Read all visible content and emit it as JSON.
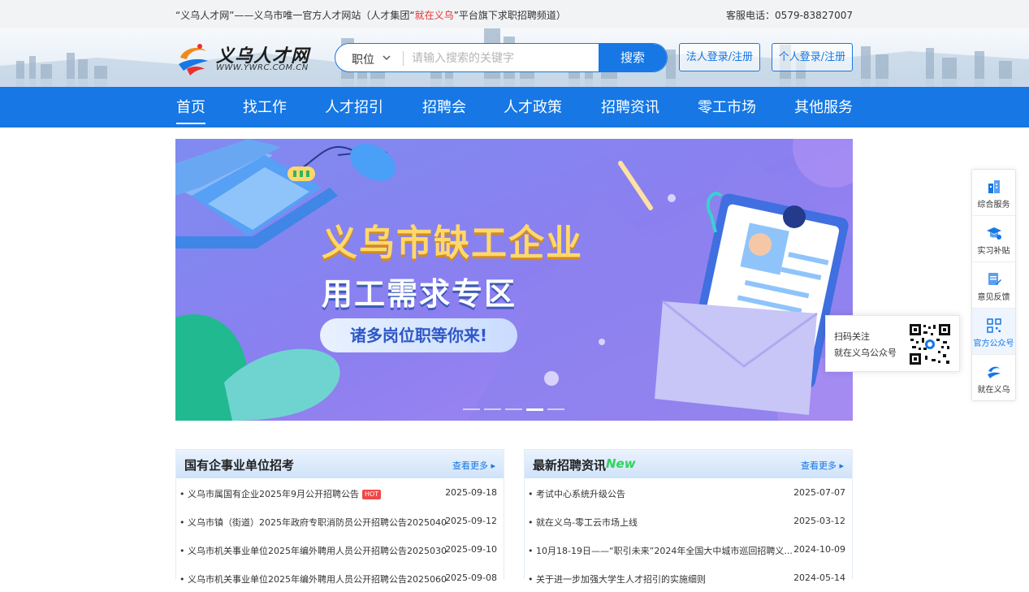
{
  "topbar": {
    "intro_part1": "“义乌人才网”——义乌市唯一官方人才网站（人才集团“",
    "intro_brand": "就在义乌",
    "intro_part2": "”平台旗下求职招聘频道）",
    "hotline": "客服电话：0579-83827007"
  },
  "logo": {
    "name": "义乌人才网",
    "url": "WWW.YWRC.COM.CN"
  },
  "search": {
    "category": "职位",
    "placeholder": "请输入搜索的关键字",
    "button": "搜索"
  },
  "login": {
    "corporate": "法人登录/注册",
    "personal": "个人登录/注册"
  },
  "nav": [
    "首页",
    "找工作",
    "人才招引",
    "招聘会",
    "人才政策",
    "招聘资讯",
    "零工市场",
    "其他服务"
  ],
  "banner": {
    "title_line1": "义乌市缺工企业",
    "title_line2": "用工需求专区",
    "slogan": "诸多岗位职等你来!",
    "slides_total": 5,
    "active_slide": 4
  },
  "panels": {
    "left": {
      "title": "国有企事业单位招考",
      "more": "查看更多",
      "items": [
        {
          "text": "• 义乌市属国有企业2025年9月公开招聘公告",
          "badge": "HOT",
          "date": "2025-09-18"
        },
        {
          "text": "• 义乌市镇（街道）2025年政府专职消防员公开招聘公告20250403",
          "badge": "",
          "date": "2025-09-12"
        },
        {
          "text": "• 义乌市机关事业单位2025年编外聘用人员公开招聘公告20250301",
          "badge": "",
          "date": "2025-09-10"
        },
        {
          "text": "• 义乌市机关事业单位2025年编外聘用人员公开招聘公告20250602",
          "badge": "",
          "date": "2025-09-08"
        }
      ]
    },
    "right": {
      "title": "最新招聘资讯",
      "badge": "New",
      "more": "查看更多",
      "items": [
        {
          "text": "• 考试中心系统升级公告",
          "date": "2025-07-07"
        },
        {
          "text": "• 就在义乌-零工云市场上线",
          "date": "2025-03-12"
        },
        {
          "text": "• 10月18-19日——“职引未来”2024年全国大中城市巡回招聘义...",
          "date": "2024-10-09"
        },
        {
          "text": "• 关于进一步加强大学生人才招引的实施细则",
          "date": "2024-05-14"
        }
      ]
    }
  },
  "sidebar": [
    {
      "label": "综合服务",
      "icon": "building-icon"
    },
    {
      "label": "实习补贴",
      "icon": "graduation-cap-icon"
    },
    {
      "label": "意见反馈",
      "icon": "feedback-icon"
    },
    {
      "label": "官方公众号",
      "icon": "qrcode-icon"
    },
    {
      "label": "就在义乌",
      "icon": "brand-logo-icon"
    }
  ],
  "qr_popup": {
    "line1": "扫码关注",
    "line2": "就在义乌公众号"
  },
  "colors": {
    "primary": "#1677e5",
    "hot": "#f04848",
    "brand_red": "#e8312f",
    "new_green": "#2fd35a"
  }
}
